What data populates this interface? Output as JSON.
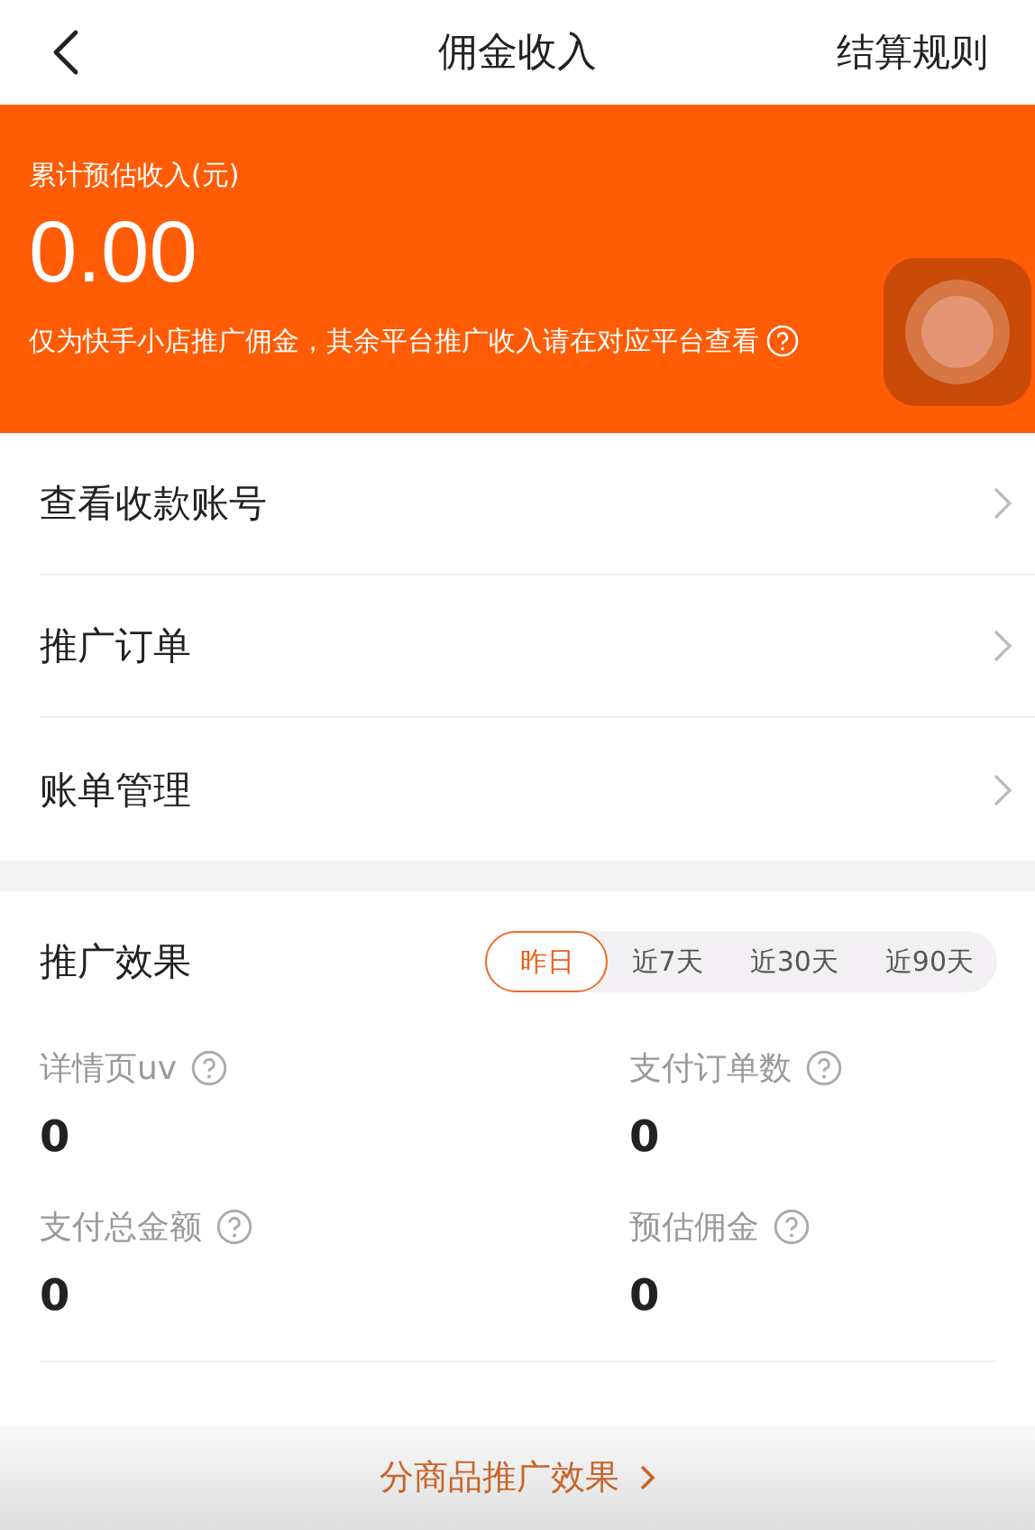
{
  "nav": {
    "title": "佣金收入",
    "action": "结算规则"
  },
  "earnings": {
    "label": "累计预估收入(元)",
    "amount": "0.00",
    "note": "仅为快手小店推广佣金，其余平台推广收入请在对应平台查看"
  },
  "menu": [
    {
      "label": "查看收款账号"
    },
    {
      "label": "推广订单"
    },
    {
      "label": "账单管理"
    }
  ],
  "effect": {
    "title": "推广效果",
    "ranges": [
      {
        "label": "昨日",
        "selected": true
      },
      {
        "label": "近7天",
        "selected": false
      },
      {
        "label": "近30天",
        "selected": false
      },
      {
        "label": "近90天",
        "selected": false
      }
    ],
    "stats": [
      {
        "label": "详情页uv",
        "value": "0"
      },
      {
        "label": "支付订单数",
        "value": "0"
      },
      {
        "label": "支付总金额",
        "value": "0"
      },
      {
        "label": "预估佣金",
        "value": "0"
      }
    ]
  },
  "footer_link": "分商品推广效果"
}
